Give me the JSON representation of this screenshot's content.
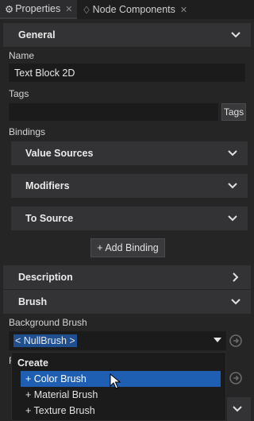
{
  "tabs": [
    {
      "label": "Properties",
      "close": "✕"
    },
    {
      "label": "Node Components",
      "close": "✕"
    }
  ],
  "sections": {
    "general": "General",
    "description": "Description",
    "brush": "Brush"
  },
  "fields": {
    "name_label": "Name",
    "name_value": "Text Block 2D",
    "tags_label": "Tags",
    "tags_value": "",
    "tags_button": "Tags",
    "bindings_label": "Bindings",
    "background_brush_label": "Background Brush",
    "background_brush_value": "< NullBrush >",
    "cut_label_fragment": "F"
  },
  "bindings": {
    "value_sources": "Value Sources",
    "modifiers": "Modifiers",
    "to_source": "To Source",
    "add_binding": "+ Add Binding"
  },
  "dropdown": {
    "header": "Create",
    "items": [
      "+ Color Brush",
      "+ Material Brush",
      "+ Texture Brush"
    ],
    "selected_index": 0
  },
  "icons": {
    "collapse": "chevron-down-icon",
    "expand": "chevron-right-icon",
    "node_components": "node-components-icon",
    "reset": "reset-arrow-icon",
    "dropdown": "dropdown-triangle-icon",
    "cursor": "mouse-pointer-icon"
  },
  "colors": {
    "background": "#252526",
    "section": "#333335",
    "field": "#1b1b1b",
    "selection": "#1e5fb3"
  }
}
